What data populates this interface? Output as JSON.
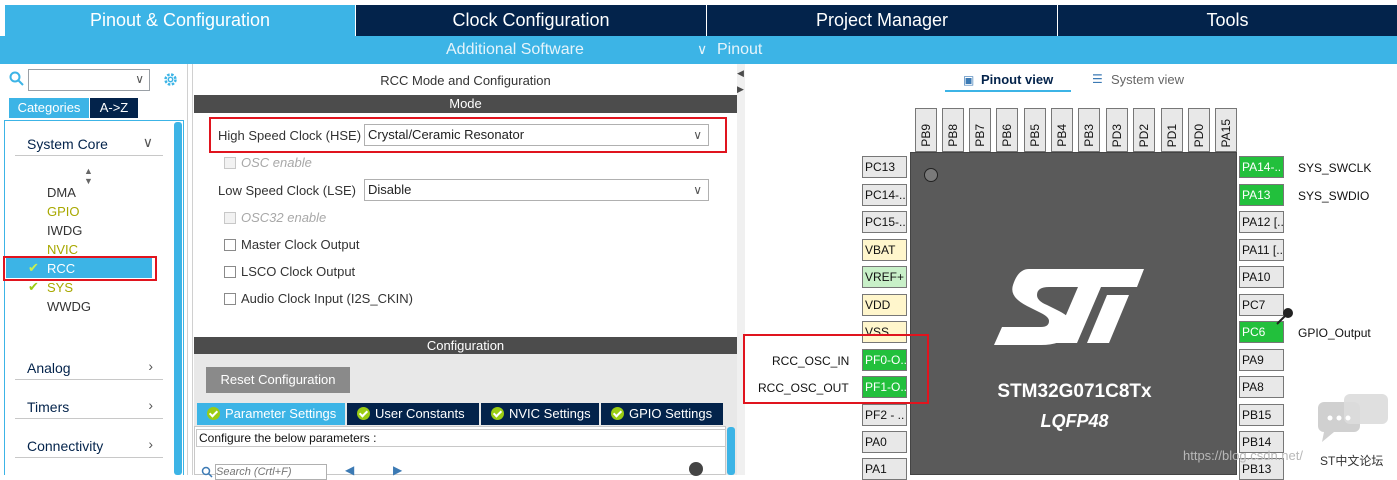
{
  "top_tabs": [
    "Pinout & Configuration",
    "Clock Configuration",
    "Project Manager",
    "Tools"
  ],
  "sub_nav": {
    "additional": "Additional Software",
    "pinout": "Pinout"
  },
  "left": {
    "tabs": [
      "Categories",
      "A->Z"
    ],
    "groups": [
      {
        "label": "System Core",
        "items": [
          "DMA",
          "GPIO",
          "IWDG",
          "NVIC",
          "RCC",
          "SYS",
          "WWDG"
        ]
      },
      {
        "label": "Analog"
      },
      {
        "label": "Timers"
      },
      {
        "label": "Connectivity"
      }
    ]
  },
  "mid": {
    "title": "RCC Mode and Configuration",
    "mode_header": "Mode",
    "hse_label": "High Speed Clock (HSE)",
    "hse_value": "Crystal/Ceramic Resonator",
    "osc_enable": "OSC enable",
    "lse_label": "Low Speed Clock (LSE)",
    "lse_value": "Disable",
    "osc32_enable": "OSC32 enable",
    "mco": "Master Clock Output",
    "lsco": "LSCO Clock Output",
    "audio": "Audio Clock Input (I2S_CKIN)",
    "config_header": "Configuration",
    "reset_btn": "Reset Configuration",
    "param_tabs": [
      "Parameter Settings",
      "User Constants",
      "NVIC Settings",
      "GPIO Settings"
    ],
    "param_hint": "Configure the below parameters :",
    "search_placeholder": "Search (Crtl+F)"
  },
  "right": {
    "pinout_view": "Pinout view",
    "system_view": "System view",
    "chip_name": "STM32G071C8Tx",
    "package": "LQFP48",
    "top_pins": [
      "PB9",
      "PB8",
      "PB7",
      "PB6",
      "PB5",
      "PB4",
      "PB3",
      "PD3",
      "PD2",
      "PD1",
      "PD0",
      "PA15"
    ],
    "left_pins": [
      "PC13",
      "PC14-..",
      "PC15-..",
      "VBAT",
      "VREF+",
      "VDD",
      "VSS",
      "PF0-O..",
      "PF1-O..",
      "PF2 - ..",
      "PA0",
      "PA1"
    ],
    "right_pins": [
      "PA14-..",
      "PA13",
      "PA12 [..",
      "PA11 [..",
      "PA10",
      "PC7",
      "PC6",
      "PA9",
      "PA8",
      "PB15",
      "PB14",
      "PB13"
    ],
    "signals": {
      "swclk": "SYS_SWCLK",
      "swdio": "SYS_SWDIO",
      "gpio_out": "GPIO_Output",
      "osc_in": "RCC_OSC_IN",
      "osc_out": "RCC_OSC_OUT"
    },
    "watermark": "https://blog.csdn.net/",
    "brand": "ST中文论坛"
  },
  "colors": {
    "accent": "#3cb4e6",
    "navy": "#03234b",
    "pin_green": "#22c03c",
    "highlight_red": "#e0141e"
  }
}
